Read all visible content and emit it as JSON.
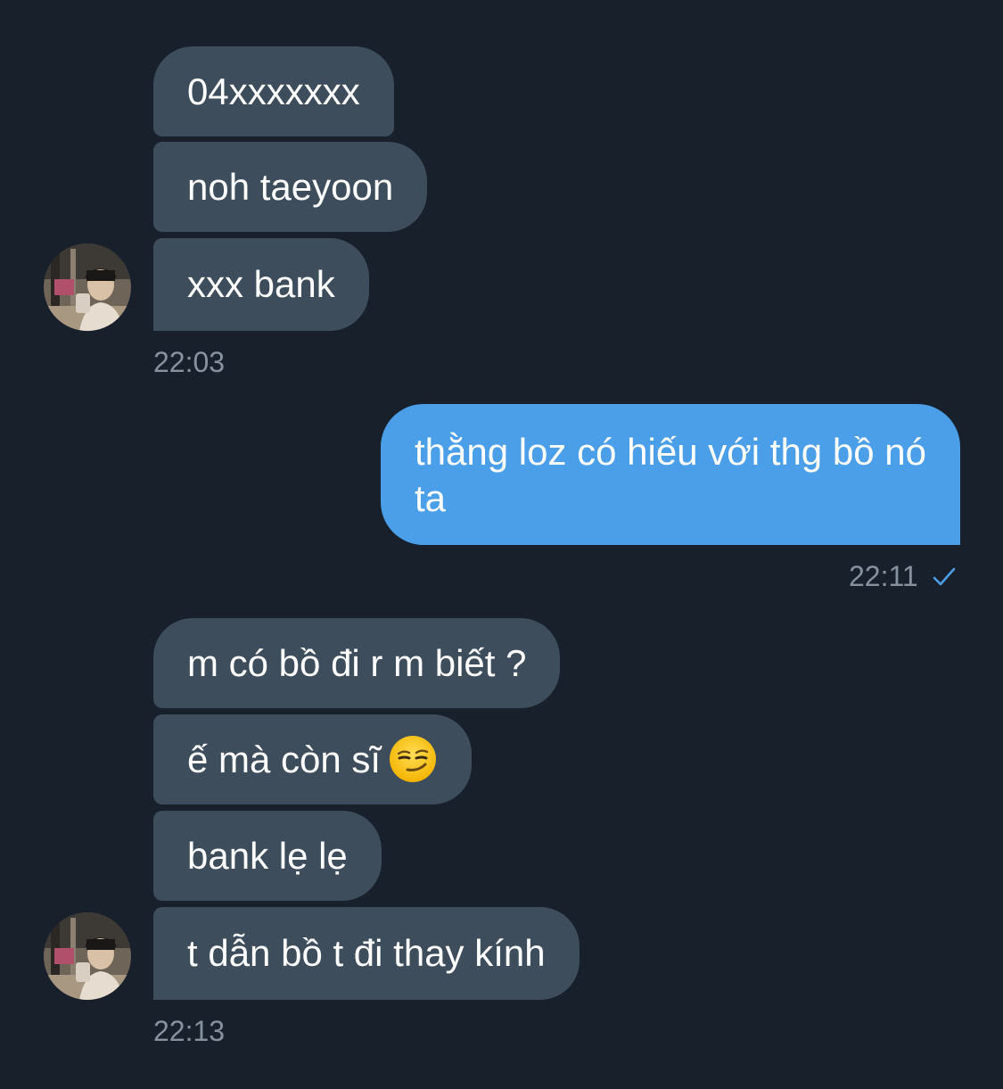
{
  "messages": {
    "group1": {
      "m1": "04xxxxxxx",
      "m2": "noh taeyoon",
      "m3": "xxx bank",
      "time": "22:03"
    },
    "outgoing": {
      "text": "thằng loz có hiếu với thg bồ nó ta",
      "time": "22:11",
      "status_icon": "check-icon"
    },
    "group2": {
      "m1": "m có bồ đi r m biết ?",
      "m2": "ế mà còn sĩ",
      "m2_emoji": "smirking-face-emoji",
      "m3": "bank lẹ lẹ",
      "m4": "t dẫn bồ t đi thay kính",
      "time": "22:13"
    }
  },
  "colors": {
    "background": "#18202b",
    "incoming_bubble": "#3e4d5c",
    "outgoing_bubble": "#4b9ee8",
    "timestamp": "#8792a0",
    "read_check": "#4b9ee8"
  }
}
